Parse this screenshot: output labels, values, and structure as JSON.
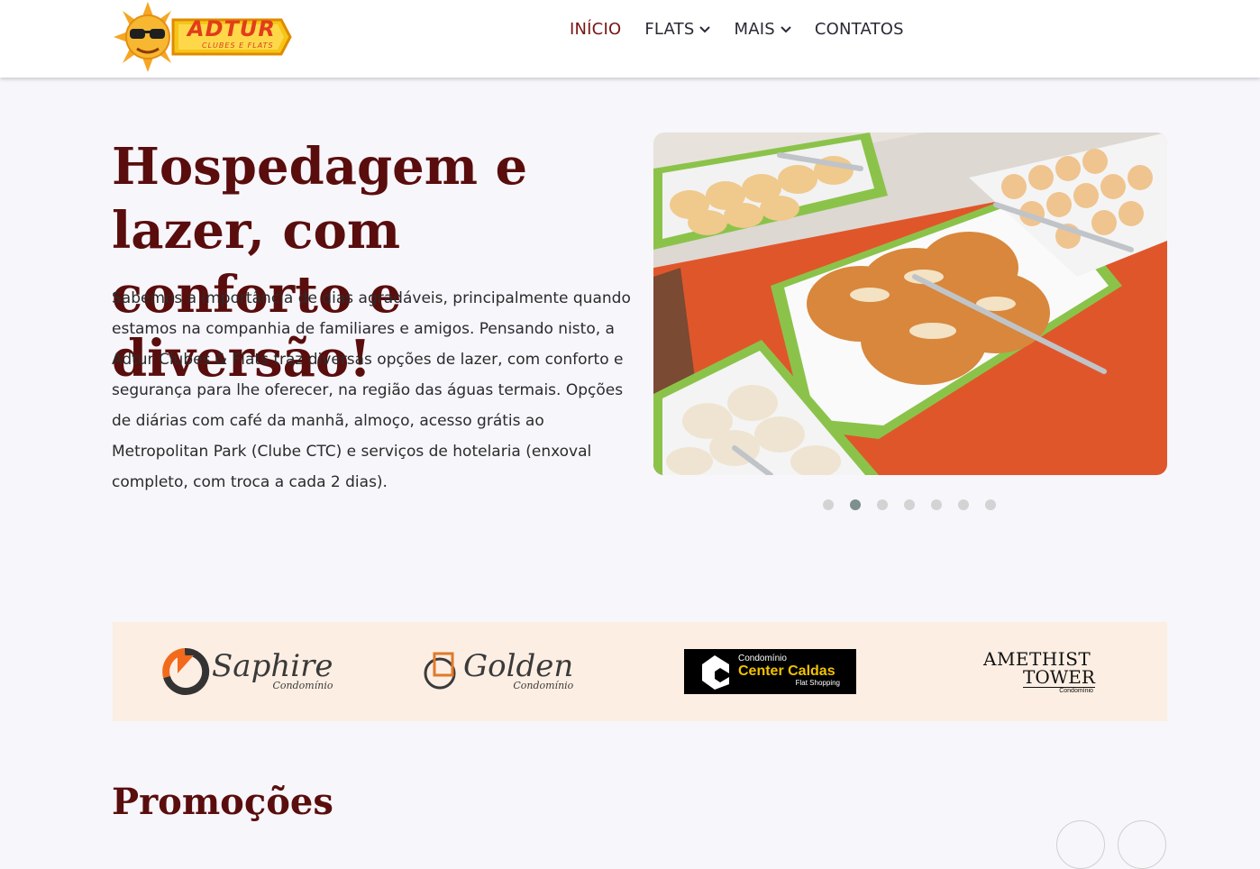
{
  "logo": {
    "brand": "ADTUR",
    "tagline": "CLUBES E FLATS"
  },
  "nav": [
    {
      "label": "INÍCIO",
      "active": true,
      "dropdown": false
    },
    {
      "label": "FLATS",
      "active": false,
      "dropdown": true
    },
    {
      "label": "MAIS",
      "active": false,
      "dropdown": true
    },
    {
      "label": "CONTATOS",
      "active": false,
      "dropdown": false
    }
  ],
  "hero": {
    "title": "Hospedagem e lazer, com conforto e diversão!",
    "text": "Sabemos a importância de dias agradáveis, principalmente quando estamos na companhia de familiares e amigos. Pensando nisto, a Adtur Clubes & Flats traz diversas opções de lazer, com conforto e segurança para lhe oferecer, na região das águas termais. Opções de diárias com café da manhã, almoço, acesso grátis ao Metropolitan Park (Clube CTC) e serviços de hotelaria (enxoval completo, com troca a cada 2 dias).",
    "carousel": {
      "slides": 7,
      "active_slide": 2
    }
  },
  "brands": {
    "saphire": {
      "name": "Saphire",
      "sub": "Condomínio"
    },
    "golden": {
      "name": "Golden",
      "sub": "Condomínio"
    },
    "center_caldas": {
      "line1": "Condomínio",
      "line2": "Center Caldas",
      "line3": "Flat Shopping"
    },
    "amethist": {
      "line1": "AMETHIST",
      "line2": "TOWER",
      "sub": "Condomínio"
    }
  },
  "promo": {
    "title": "Promoções"
  },
  "colors": {
    "accent": "#5a0d0d",
    "nav_active": "#7a1414",
    "brands_bg": "#fdeee3",
    "page_bg": "#f7f6fb"
  }
}
